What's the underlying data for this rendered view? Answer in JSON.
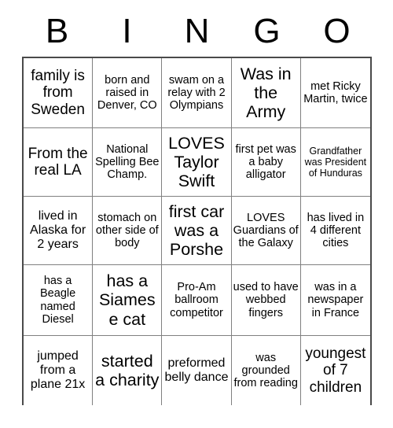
{
  "header": {
    "letters": [
      "B",
      "I",
      "N",
      "G",
      "O"
    ]
  },
  "grid": {
    "rows": 5,
    "columns": 5,
    "cells": [
      {
        "text": "family is from Sweden",
        "size": "sz-l"
      },
      {
        "text": "born and raised in Denver, CO",
        "size": "sz-s"
      },
      {
        "text": "swam on a relay with 2 Olympians",
        "size": "sz-s"
      },
      {
        "text": "Was in the Army",
        "size": "sz-xl"
      },
      {
        "text": "met Ricky Martin, twice",
        "size": "sz-s"
      },
      {
        "text": "From the real LA",
        "size": "sz-l"
      },
      {
        "text": "National Spelling Bee Champ.",
        "size": "sz-s"
      },
      {
        "text": "LOVES Taylor Swift",
        "size": "sz-xl"
      },
      {
        "text": "first pet was a baby alligator",
        "size": "sz-s"
      },
      {
        "text": "Grandfather was President of Hunduras",
        "size": "sz-xs"
      },
      {
        "text": "lived in Alaska for 2 years",
        "size": "sz-m"
      },
      {
        "text": "stomach on other side of body",
        "size": "sz-s"
      },
      {
        "text": "first car was a Porshe",
        "size": "sz-xl"
      },
      {
        "text": "LOVES Guardians of the Galaxy",
        "size": "sz-s"
      },
      {
        "text": "has lived in 4 different cities",
        "size": "sz-s"
      },
      {
        "text": "has a Beagle named Diesel",
        "size": "sz-s"
      },
      {
        "text": "has a Siamese cat",
        "size": "sz-xl"
      },
      {
        "text": "Pro-Am ballroom competitor",
        "size": "sz-s"
      },
      {
        "text": "used to have webbed fingers",
        "size": "sz-s"
      },
      {
        "text": "was in a newspaper in France",
        "size": "sz-s"
      },
      {
        "text": "jumped from a plane 21x",
        "size": "sz-m"
      },
      {
        "text": "started a charity",
        "size": "sz-xl"
      },
      {
        "text": "preformed belly dance",
        "size": "sz-m"
      },
      {
        "text": "was grounded from reading",
        "size": "sz-s"
      },
      {
        "text": "youngest of 7 children",
        "size": "sz-l"
      }
    ]
  }
}
